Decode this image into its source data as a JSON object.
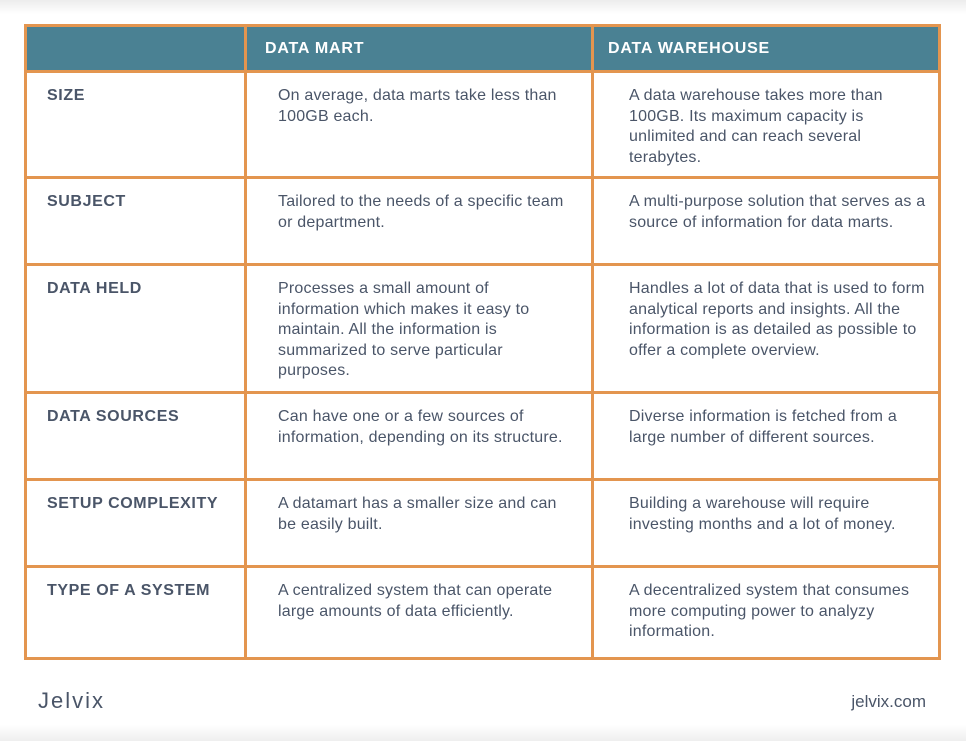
{
  "table": {
    "headers": [
      "",
      "DATA MART",
      "DATA WAREHOUSE"
    ],
    "rows": [
      {
        "label": "SIZE",
        "data_mart": "On average, data marts take less than 100GB each.",
        "data_warehouse": "A data warehouse takes more than 100GB. Its maximum capacity is unlimited and can reach several terabytes."
      },
      {
        "label": "SUBJECT",
        "data_mart": "Tailored to the needs of a specific team or department.",
        "data_warehouse": "A multi-purpose solution that serves as a source of information for data marts."
      },
      {
        "label": "DATA HELD",
        "data_mart": "Processes a small amount of information which makes it easy to maintain. All the information is summarized to serve particular purposes.",
        "data_warehouse": "Handles a lot of data that is used to form analytical reports and insights. All the information is as detailed as possible to offer a complete overview."
      },
      {
        "label": "DATA SOURCES",
        "data_mart": "Can have one or a few sources of information, depending on its structure.",
        "data_warehouse": "Diverse information is fetched from a large number of different sources."
      },
      {
        "label": "SETUP COMPLEXITY",
        "data_mart": "A datamart has a smaller size and can be easily built.",
        "data_warehouse": "Building a warehouse will require investing months and a lot of money."
      },
      {
        "label": "TYPE OF A SYSTEM",
        "data_mart": "A centralized system that can operate large amounts of data efficiently.",
        "data_warehouse": "A decentralized system that consumes more computing power to analyzy information."
      }
    ]
  },
  "footer": {
    "brand": "Jelvix",
    "site": "jelvix.com"
  },
  "colors": {
    "header_bg": "#4a8193",
    "border": "#e3954f",
    "text": "#4a5568"
  }
}
